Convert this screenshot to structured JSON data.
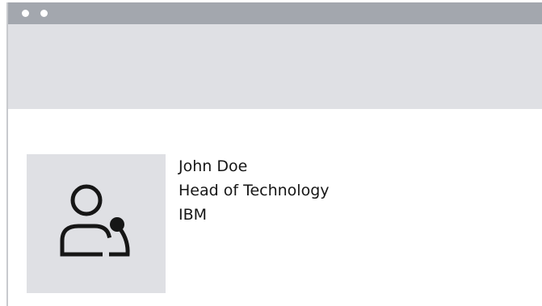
{
  "window": {
    "controls": [
      "dot",
      "dot"
    ]
  },
  "profile": {
    "avatar_icon": "user-speaker-icon",
    "name": "John Doe",
    "title": "Head of Technology",
    "company": "IBM"
  },
  "colors": {
    "titlebar": "#a3a7ae",
    "banner": "#dfe0e4",
    "avatar_background": "#dfe0e4",
    "text": "#161616",
    "window_controls": "#ffffff"
  }
}
